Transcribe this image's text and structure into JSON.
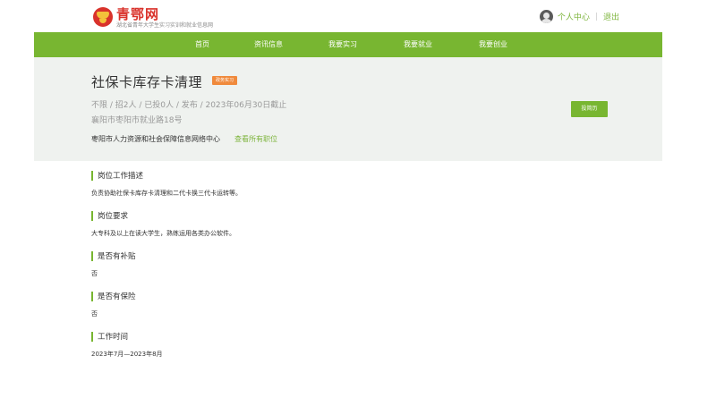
{
  "header": {
    "logo_title": "青鄂网",
    "logo_subtitle": "湖北省青年大学生实习实训和就业信息网",
    "personal_center": "个人中心",
    "logout": "退出"
  },
  "nav": {
    "items": [
      "首页",
      "资讯信息",
      "我要实习",
      "我要就业",
      "我要创业"
    ]
  },
  "job": {
    "title": "社保卡库存卡清理",
    "tag": "政务实习",
    "meta": "不限 / 招2人 / 已投0人 / 发布 / 2023年06月30日截止",
    "address": "襄阳市枣阳市就业路18号",
    "organization": "枣阳市人力资源和社会保障信息网络中心",
    "view_all": "查看所有职位",
    "apply_button": "投简历"
  },
  "sections": [
    {
      "title": "岗位工作描述",
      "body": "负责协助社保卡库存卡清理和二代卡换三代卡运转等。"
    },
    {
      "title": "岗位要求",
      "body": "大专科及以上在读大学生，熟练运用各类办公软件。"
    },
    {
      "title": "是否有补贴",
      "body": "否"
    },
    {
      "title": "是否有保险",
      "body": "否"
    },
    {
      "title": "工作时间",
      "body": "2023年7月—2023年8月"
    }
  ],
  "colors": {
    "accent_green": "#78b631",
    "tag_orange": "#f08a3c",
    "logo_red": "#d9322b",
    "banner_bg": "#eff2ef"
  }
}
